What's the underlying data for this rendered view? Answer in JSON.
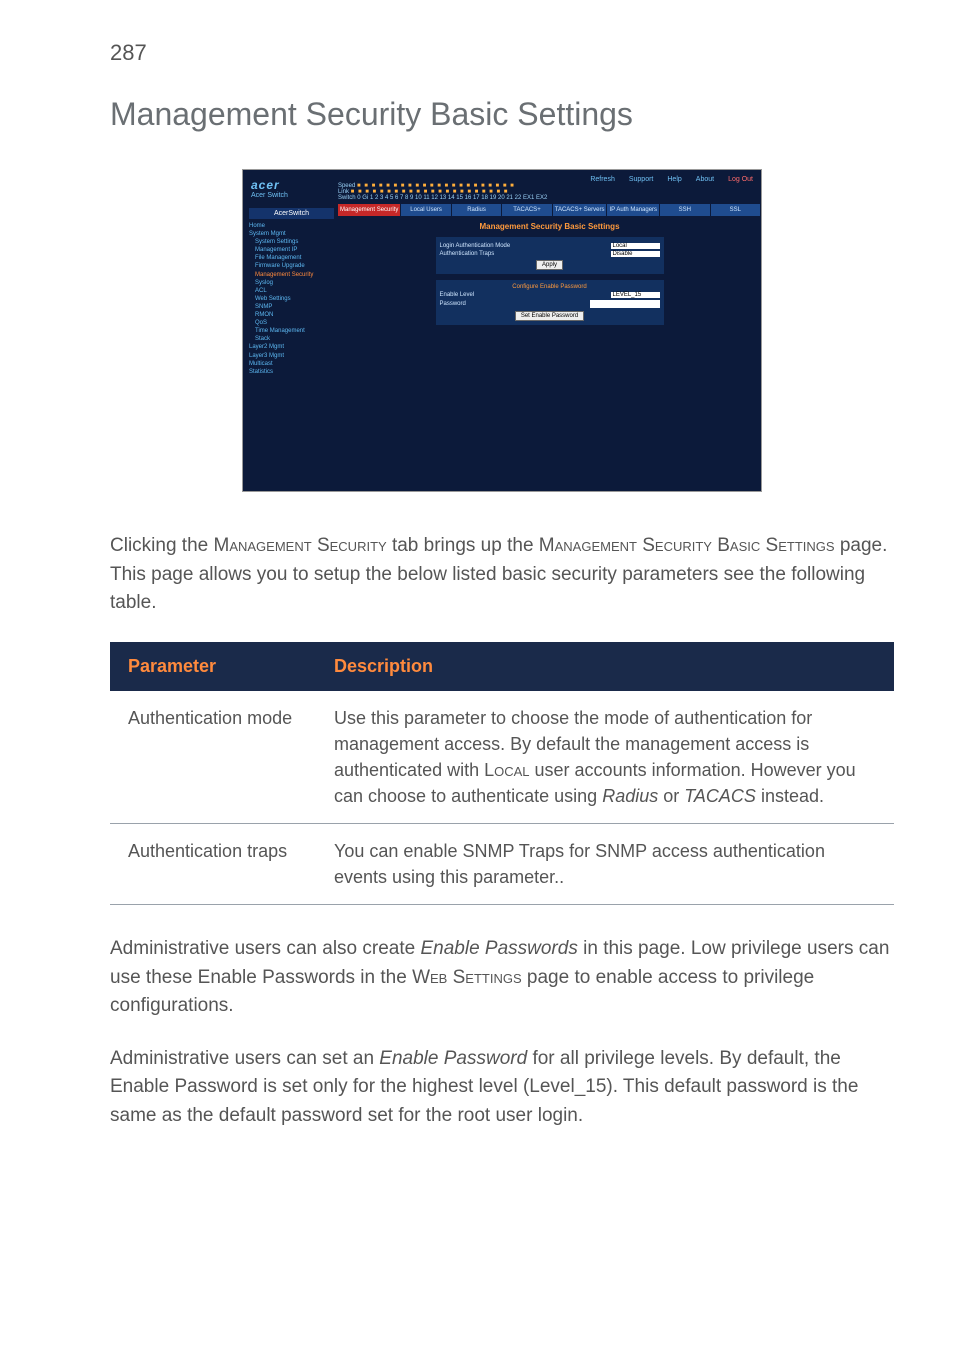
{
  "page_number": "287",
  "title": "Management Security Basic Settings",
  "screenshot": {
    "logo": "acer",
    "logo_sub": "Acer Switch",
    "toplinks": {
      "refresh": "Refresh",
      "support": "Support",
      "help": "Help",
      "about": "About",
      "logout": "Log Out"
    },
    "ports": {
      "speed_label": "Speed",
      "link_label": "Link",
      "row": "Switch 0 Gi 1 2 3 4 5 6 7 8 9 10 11 12 13 14 15 16 17 18 19 20 21 22 EX1 EX2"
    },
    "sidebar_title": "AcerSwitch",
    "sidebar": [
      "Home",
      "System Mgmt",
      "System Settings",
      "Management IP",
      "File Management",
      "Firmware Upgrade",
      "Management Security",
      "Syslog",
      "ACL",
      "Web Settings",
      "SNMP",
      "RMON",
      "QoS",
      "Time Management",
      "Stack",
      "Layer2 Mgmt",
      "Layer3 Mgmt",
      "Multicast",
      "Statistics"
    ],
    "tabs": [
      "Management Security",
      "Local Users",
      "Radius",
      "TACACS+",
      "TACACS+ Servers",
      "IP Auth Managers",
      "SSH",
      "SSL"
    ],
    "heading": "Management Security Basic Settings",
    "form1": {
      "row1_label": "Login Authentication Mode",
      "row1_value": "Local",
      "row2_label": "Authentication Traps",
      "row2_value": "Disable",
      "apply": "Apply"
    },
    "form2": {
      "subhead": "Configure Enable Password",
      "row1_label": "Enable Level",
      "row1_value": "LEVEL_15",
      "row2_label": "Password",
      "btn": "Set Enable Password"
    }
  },
  "para1": {
    "a": "Clicking the ",
    "b": "Management Security",
    "c": " tab brings up the ",
    "d": "Management Security Basic Settings",
    "e": " page. This page allows you to setup the below listed basic security parameters see the following table."
  },
  "table": {
    "header_param": "Parameter",
    "header_desc": "Description",
    "rows": [
      {
        "param": "Authentication mode",
        "desc_a": "Use this parameter to choose the mode of authentication for management access. By default the management access is authenticated with ",
        "desc_b": "Local",
        "desc_c": " user accounts information. However you can choose to authenticate using ",
        "desc_d": "Radius",
        "desc_e": " or ",
        "desc_f": "TACACS",
        "desc_g": " instead."
      },
      {
        "param": "Authentication traps",
        "desc_a": "You can enable SNMP Traps for SNMP access authentication events using this parameter.."
      }
    ]
  },
  "para2": {
    "a": "Administrative users can also create ",
    "b": "Enable Passwords",
    "c": " in this page. Low privilege users can use these Enable Passwords in the ",
    "d": "Web Settings",
    "e": " page to enable access to privilege configurations."
  },
  "para3": {
    "a": "Administrative users can set an ",
    "b": "Enable Password",
    "c": " for all privilege levels. By default, the Enable Password is set only for the highest level (Level_15). This default password is the same as the default password set for the root user login."
  }
}
